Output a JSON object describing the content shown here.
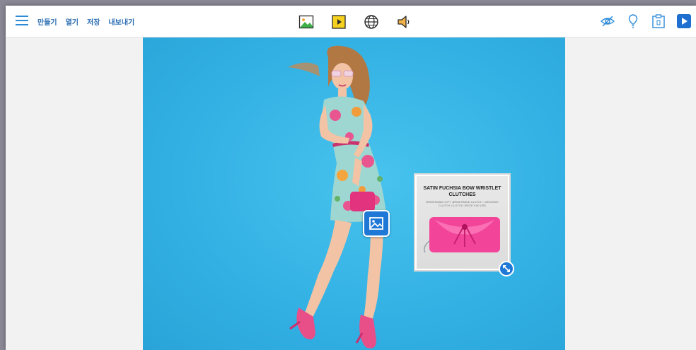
{
  "menu": {
    "items": [
      {
        "label": "만들기"
      },
      {
        "label": "열기"
      },
      {
        "label": "저장"
      },
      {
        "label": "내보내기"
      }
    ]
  },
  "toolbar": {
    "center_icons": [
      "image-icon",
      "video-icon",
      "globe-icon",
      "speaker-icon"
    ],
    "right_icons": [
      "eye-off-icon",
      "pin-icon",
      "clipboard-icon",
      "play-icon"
    ],
    "accent_color": "#2e8bd8"
  },
  "canvas": {
    "background_color": "#35b4e6"
  },
  "popup": {
    "title": "SATIN FUCHSIA BOW WRISTLET CLUTCHES",
    "subtitle": "BRIDESMAID GIFT ,BRIDESMAID CLUTCH , WEDDING CLUTCH ,CLUTCH ,PIECE 9.80 USD"
  }
}
